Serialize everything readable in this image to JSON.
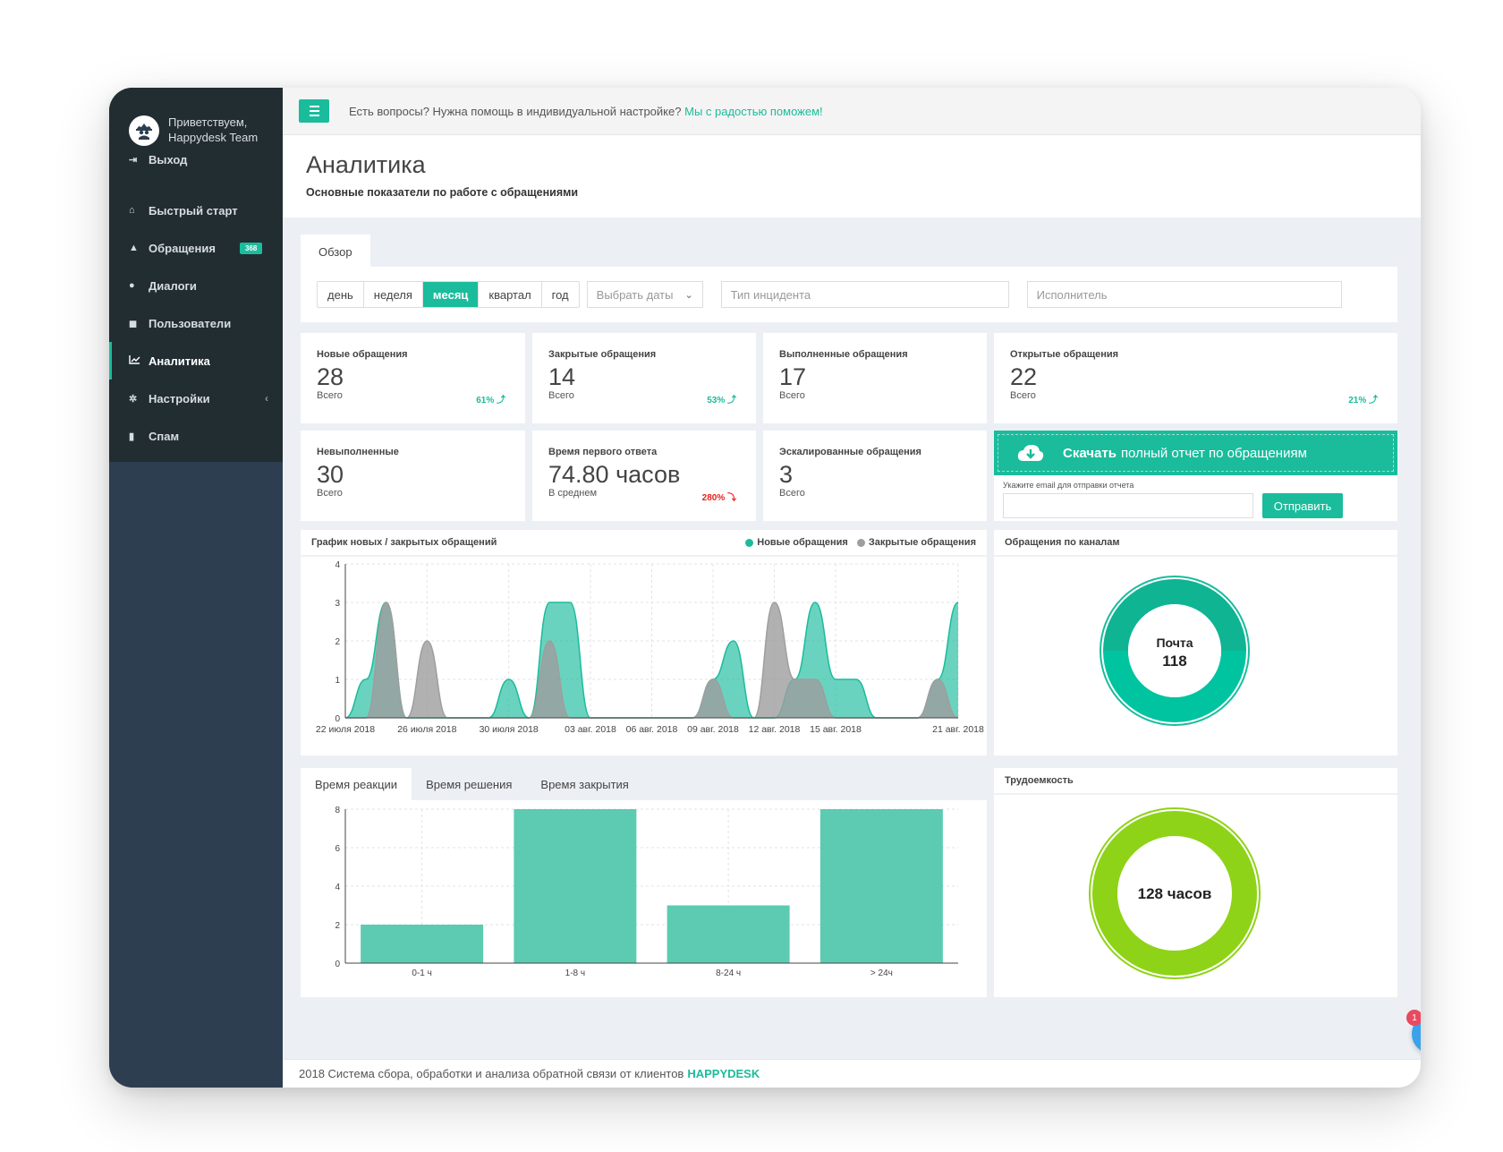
{
  "sidebar": {
    "greeting": "Приветствуем,",
    "user": "Happydesk Team",
    "logout": "Выход",
    "items": [
      {
        "label": "Быстрый старт",
        "icon": "home-icon"
      },
      {
        "label": "Обращения",
        "icon": "warning-icon",
        "badge": "368"
      },
      {
        "label": "Диалоги",
        "icon": "chat-icon"
      },
      {
        "label": "Пользователи",
        "icon": "users-icon"
      },
      {
        "label": "Аналитика",
        "icon": "chart-icon",
        "active": true
      },
      {
        "label": "Настройки",
        "icon": "gear-icon"
      },
      {
        "label": "Спам",
        "icon": "trash-icon"
      }
    ]
  },
  "topbar": {
    "help_text": "Есть вопросы? Нужна помощь в индивидуальной настройке?",
    "help_link": "Мы с радостью поможем!"
  },
  "header": {
    "title": "Аналитика",
    "subtitle": "Основные показатели по работе с обращениями"
  },
  "tabs": {
    "overview": "Обзор"
  },
  "filters": {
    "periods": [
      "день",
      "неделя",
      "месяц",
      "квартал",
      "год"
    ],
    "active_period": "месяц",
    "date_select": "Выбрать даты",
    "incident_type_placeholder": "Тип инцидента",
    "assignee_placeholder": "Исполнитель"
  },
  "cards": [
    {
      "label": "Новые обращения",
      "value": "28",
      "sub": "Всего",
      "pct": "61% ⤴",
      "trend": "up"
    },
    {
      "label": "Закрытые обращения",
      "value": "14",
      "sub": "Всего",
      "pct": "53% ⤴",
      "trend": "up"
    },
    {
      "label": "Выполненные обращения",
      "value": "17",
      "sub": "Всего",
      "pct": "",
      "trend": ""
    },
    {
      "label": "Открытые обращения",
      "value": "22",
      "sub": "Всего",
      "pct": "21% ⤴",
      "trend": "up"
    },
    {
      "label": "Невыполненные",
      "value": "30",
      "sub": "Всего",
      "pct": "",
      "trend": ""
    },
    {
      "label": "Время первого ответа",
      "value": "74.80 часов",
      "sub": "В среднем",
      "pct": "280% ⤵",
      "trend": "down"
    },
    {
      "label": "Эскалированные обращения",
      "value": "3",
      "sub": "Всего",
      "pct": "",
      "trend": ""
    }
  ],
  "report": {
    "download_bold": "Скачать",
    "download_rest": "полный отчет по обращениям",
    "email_label": "Укажите email для отправки отчета",
    "send": "Отправить"
  },
  "colors": {
    "accent": "#1abc9c",
    "closed": "#9e9e9e",
    "lime": "#8ed317",
    "danger": "#e8211c"
  },
  "area_chart_title": "График новых / закрытых обращений",
  "channels_title": "Обращения по каналам",
  "channels_center": {
    "label": "Почта",
    "value": "118"
  },
  "labor_title": "Трудоемкость",
  "labor_center": "128 часов",
  "time_tabs": [
    "Время реакции",
    "Время решения",
    "Время закрытия"
  ],
  "chart_data": [
    {
      "type": "area",
      "title": "График новых / закрытых обращений",
      "ylim": [
        0,
        4
      ],
      "yticks": [
        0,
        1,
        2,
        3,
        4
      ],
      "x_ticks": [
        "22 июля 2018",
        "26 июля 2018",
        "30 июля 2018",
        "03 авг. 2018",
        "06 авг. 2018",
        "09 авг. 2018",
        "12 авг. 2018",
        "15 авг. 2018",
        "21 авг. 2018"
      ],
      "x_domain": [
        0,
        30
      ],
      "x_tick_pos": [
        0,
        4,
        8,
        12,
        15,
        18,
        21,
        24,
        30
      ],
      "series": [
        {
          "name": "Новые обращения",
          "color": "#1abc9c",
          "points": [
            [
              0,
              0
            ],
            [
              1,
              1
            ],
            [
              2,
              3
            ],
            [
              3,
              0
            ],
            [
              4,
              0
            ],
            [
              5,
              0
            ],
            [
              6,
              0
            ],
            [
              7,
              0
            ],
            [
              8,
              1
            ],
            [
              9,
              0
            ],
            [
              10,
              3
            ],
            [
              11,
              3
            ],
            [
              12,
              0
            ],
            [
              13,
              0
            ],
            [
              14,
              0
            ],
            [
              15,
              0
            ],
            [
              16,
              0
            ],
            [
              17,
              0
            ],
            [
              18,
              1
            ],
            [
              19,
              2
            ],
            [
              20,
              0
            ],
            [
              21,
              0
            ],
            [
              22,
              1
            ],
            [
              23,
              3
            ],
            [
              24,
              1
            ],
            [
              25,
              1
            ],
            [
              26,
              0
            ],
            [
              27,
              0
            ],
            [
              28,
              0
            ],
            [
              29,
              1
            ],
            [
              30,
              3
            ]
          ]
        },
        {
          "name": "Закрытые обращения",
          "color": "#9e9e9e",
          "points": [
            [
              0,
              0
            ],
            [
              1,
              0
            ],
            [
              2,
              3
            ],
            [
              3,
              0
            ],
            [
              4,
              2
            ],
            [
              5,
              0
            ],
            [
              6,
              0
            ],
            [
              7,
              0
            ],
            [
              8,
              0
            ],
            [
              9,
              0
            ],
            [
              10,
              2
            ],
            [
              11,
              0
            ],
            [
              12,
              0
            ],
            [
              13,
              0
            ],
            [
              14,
              0
            ],
            [
              15,
              0
            ],
            [
              16,
              0
            ],
            [
              17,
              0
            ],
            [
              18,
              1
            ],
            [
              19,
              0
            ],
            [
              20,
              0
            ],
            [
              21,
              3
            ],
            [
              22,
              1
            ],
            [
              23,
              1
            ],
            [
              24,
              0
            ],
            [
              25,
              0
            ],
            [
              26,
              0
            ],
            [
              27,
              0
            ],
            [
              28,
              0
            ],
            [
              29,
              1
            ],
            [
              30,
              0
            ]
          ]
        }
      ]
    },
    {
      "type": "pie",
      "title": "Обращения по каналам",
      "slices": [
        {
          "name": "Почта",
          "value": 118
        }
      ]
    },
    {
      "type": "bar",
      "title": "Время реакции",
      "categories": [
        "0-1 ч",
        "1-8 ч",
        "8-24 ч",
        "> 24ч"
      ],
      "values": [
        2,
        8,
        3,
        8
      ],
      "ylim": [
        0,
        8
      ],
      "yticks": [
        0,
        2,
        4,
        6,
        8
      ]
    },
    {
      "type": "pie",
      "title": "Трудоемкость",
      "slices": [
        {
          "name": "128 часов",
          "value": 128
        }
      ]
    }
  ],
  "footer": {
    "text": "2018 Система сбора, обработки и анализа обратной связи от клиентов",
    "brand": "HAPPYDESK"
  },
  "help_widget": {
    "badge": "1",
    "label": "?"
  }
}
